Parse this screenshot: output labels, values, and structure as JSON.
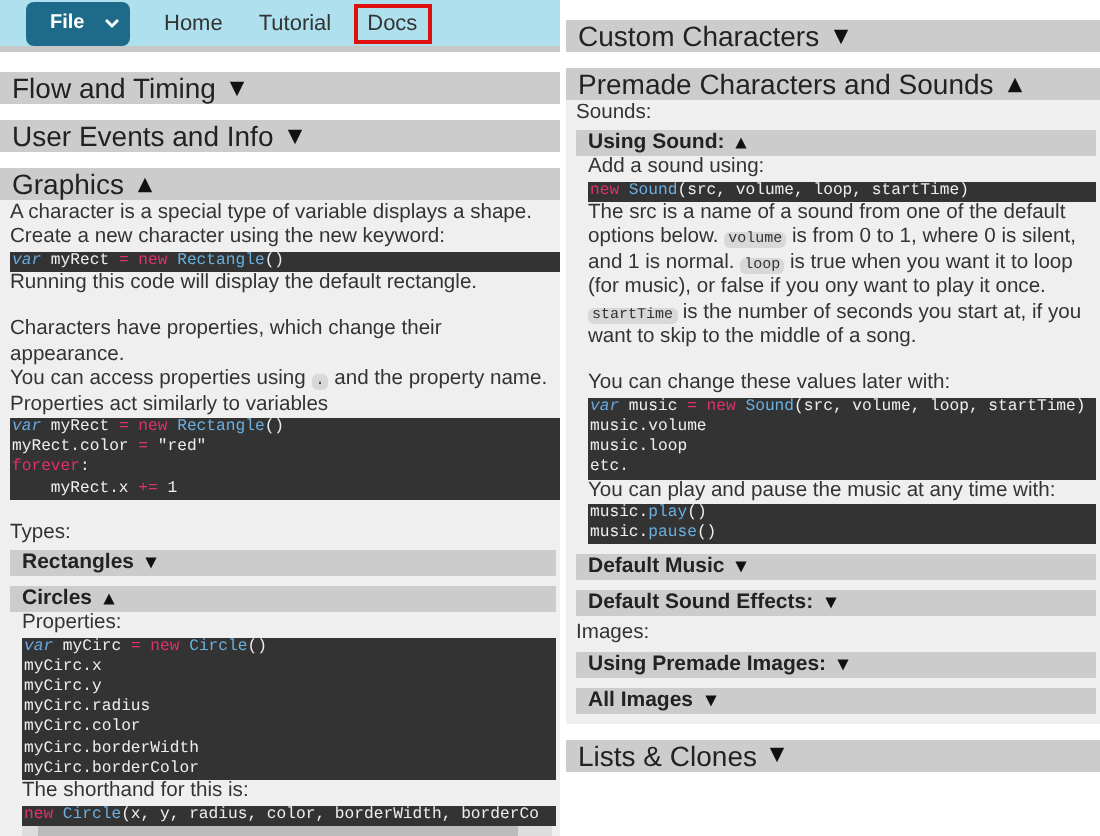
{
  "nav": {
    "file_button": "File",
    "links": [
      {
        "label": "Home",
        "selected": false
      },
      {
        "label": "Tutorial",
        "selected": false
      },
      {
        "label": "Docs",
        "selected": true
      }
    ]
  },
  "left_sections": [
    {
      "title": "Flow and Timing",
      "expanded": false
    },
    {
      "title": "User Events and Info",
      "expanded": false
    },
    {
      "title": "Graphics",
      "expanded": true,
      "blocks": [
        {
          "kind": "text",
          "parts": [
            {
              "kind": "plain",
              "text": "A character is a special type of variable displays a shape."
            }
          ]
        },
        {
          "kind": "text",
          "parts": [
            {
              "kind": "plain",
              "text": "Create a new character using the new keyword:"
            }
          ]
        },
        {
          "kind": "code",
          "lines": [
            [
              {
                "kind": "kw",
                "text": "var"
              },
              {
                "kind": "plain",
                "text": " myRect "
              },
              {
                "kind": "op",
                "text": "= new"
              },
              {
                "kind": "fn",
                "text": " Rectangle"
              },
              {
                "kind": "plain",
                "text": "()"
              }
            ]
          ]
        },
        {
          "kind": "text",
          "parts": [
            {
              "kind": "plain",
              "text": "Running this code will display the default rectangle."
            }
          ]
        },
        {
          "kind": "gap"
        },
        {
          "kind": "text",
          "parts": [
            {
              "kind": "plain",
              "text": "Characters have properties, which change their appearance."
            }
          ]
        },
        {
          "kind": "text",
          "parts": [
            {
              "kind": "plain",
              "text": "You can access properties using "
            },
            {
              "kind": "code",
              "text": "."
            },
            {
              "kind": "plain",
              "text": " and the property name."
            }
          ]
        },
        {
          "kind": "text",
          "parts": [
            {
              "kind": "plain",
              "text": "Properties act similarly to variables"
            }
          ]
        },
        {
          "kind": "code",
          "lines": [
            [
              {
                "kind": "kw",
                "text": "var"
              },
              {
                "kind": "plain",
                "text": " myRect "
              },
              {
                "kind": "op",
                "text": "= new"
              },
              {
                "kind": "fn",
                "text": " Rectangle"
              },
              {
                "kind": "plain",
                "text": "()"
              }
            ],
            [
              {
                "kind": "plain",
                "text": "myRect.color "
              },
              {
                "kind": "op",
                "text": "="
              },
              {
                "kind": "plain",
                "text": " \"red\""
              }
            ],
            [
              {
                "kind": "op",
                "text": "forever"
              },
              {
                "kind": "plain",
                "text": ":"
              }
            ],
            [
              {
                "kind": "plain",
                "text": "    myRect.x "
              },
              {
                "kind": "op",
                "text": "+="
              },
              {
                "kind": "plain",
                "text": " 1"
              }
            ]
          ]
        },
        {
          "kind": "gap"
        },
        {
          "kind": "text",
          "parts": [
            {
              "kind": "plain",
              "text": "Types:"
            }
          ]
        },
        {
          "kind": "sub",
          "title": "Rectangles",
          "expanded": false
        },
        {
          "kind": "sub",
          "title": "Circles",
          "expanded": true,
          "blocks": [
            {
              "kind": "text",
              "parts": [
                {
                  "kind": "plain",
                  "text": "Properties:"
                }
              ]
            },
            {
              "kind": "code",
              "lines": [
                [
                  {
                    "kind": "kw",
                    "text": "var"
                  },
                  {
                    "kind": "plain",
                    "text": " myCirc "
                  },
                  {
                    "kind": "op",
                    "text": "= new"
                  },
                  {
                    "kind": "fn",
                    "text": " Circle"
                  },
                  {
                    "kind": "plain",
                    "text": "()"
                  }
                ],
                [
                  {
                    "kind": "plain",
                    "text": "myCirc.x"
                  }
                ],
                [
                  {
                    "kind": "plain",
                    "text": "myCirc.y"
                  }
                ],
                [
                  {
                    "kind": "plain",
                    "text": "myCirc.radius"
                  }
                ],
                [
                  {
                    "kind": "plain",
                    "text": "myCirc.color"
                  }
                ],
                [
                  {
                    "kind": "plain",
                    "text": "myCirc.borderWidth"
                  }
                ],
                [
                  {
                    "kind": "plain",
                    "text": "myCirc.borderColor"
                  }
                ]
              ]
            },
            {
              "kind": "text",
              "parts": [
                {
                  "kind": "plain",
                  "text": "The shorthand for this is:"
                }
              ]
            },
            {
              "kind": "scrollcode",
              "lines": [
                [
                  {
                    "kind": "op",
                    "text": "new"
                  },
                  {
                    "kind": "fn",
                    "text": " Circle"
                  },
                  {
                    "kind": "plain",
                    "text": "(x, y, radius, color, borderWidth, borderCo"
                  }
                ]
              ]
            }
          ]
        }
      ]
    }
  ],
  "right_sections": [
    {
      "title": "Custom Characters",
      "expanded": false
    },
    {
      "title": "Premade Characters and Sounds",
      "expanded": true,
      "blocks": [
        {
          "kind": "text",
          "parts": [
            {
              "kind": "plain",
              "text": "Sounds:"
            }
          ]
        },
        {
          "kind": "sub",
          "title": "Using Sound:",
          "expanded": true,
          "blocks": [
            {
              "kind": "text",
              "parts": [
                {
                  "kind": "plain",
                  "text": "Add a sound using:"
                }
              ]
            },
            {
              "kind": "code",
              "lines": [
                [
                  {
                    "kind": "op",
                    "text": "new"
                  },
                  {
                    "kind": "fn",
                    "text": " Sound"
                  },
                  {
                    "kind": "plain",
                    "text": "(src, volume, loop, startTime)"
                  }
                ]
              ]
            },
            {
              "kind": "text",
              "parts": [
                {
                  "kind": "plain",
                  "text": "The src is a name of a sound from one of the default options below. "
                },
                {
                  "kind": "code",
                  "text": "volume"
                },
                {
                  "kind": "plain",
                  "text": " is from 0 to 1, where 0 is silent, and 1 is normal. "
                },
                {
                  "kind": "code",
                  "text": "loop"
                },
                {
                  "kind": "plain",
                  "text": " is true when you want it to loop (for music), or false if you ony want to play it once. "
                },
                {
                  "kind": "code",
                  "text": "startTime"
                },
                {
                  "kind": "plain",
                  "text": " is the number of seconds you start at, if you want to skip to the middle of a song."
                }
              ]
            },
            {
              "kind": "gap"
            },
            {
              "kind": "text",
              "parts": [
                {
                  "kind": "plain",
                  "text": "You can change these values later with:"
                }
              ]
            },
            {
              "kind": "code",
              "lines": [
                [
                  {
                    "kind": "kw",
                    "text": "var"
                  },
                  {
                    "kind": "plain",
                    "text": " music "
                  },
                  {
                    "kind": "op",
                    "text": "= new"
                  },
                  {
                    "kind": "fn",
                    "text": " Sound"
                  },
                  {
                    "kind": "plain",
                    "text": "(src, volume, loop, startTime)"
                  }
                ],
                [
                  {
                    "kind": "plain",
                    "text": "music.volume"
                  }
                ],
                [
                  {
                    "kind": "plain",
                    "text": "music.loop"
                  }
                ],
                [
                  {
                    "kind": "plain",
                    "text": "etc."
                  }
                ]
              ]
            },
            {
              "kind": "text",
              "parts": [
                {
                  "kind": "plain",
                  "text": "You can play and pause the music at any time with:"
                }
              ]
            },
            {
              "kind": "code",
              "lines": [
                [
                  {
                    "kind": "plain",
                    "text": "music."
                  },
                  {
                    "kind": "fn",
                    "text": "play"
                  },
                  {
                    "kind": "plain",
                    "text": "()"
                  }
                ],
                [
                  {
                    "kind": "plain",
                    "text": "music."
                  },
                  {
                    "kind": "fn",
                    "text": "pause"
                  },
                  {
                    "kind": "plain",
                    "text": "()"
                  }
                ]
              ]
            }
          ]
        },
        {
          "kind": "sub",
          "title": "Default Music",
          "expanded": false
        },
        {
          "kind": "sub",
          "title": "Default Sound Effects:",
          "expanded": false
        },
        {
          "kind": "text",
          "parts": [
            {
              "kind": "plain",
              "text": "Images:"
            }
          ]
        },
        {
          "kind": "sub",
          "title": "Using Premade Images:",
          "expanded": false
        },
        {
          "kind": "sub",
          "title": "All Images",
          "expanded": false
        }
      ]
    },
    {
      "title": "Lists & Clones",
      "expanded": false
    }
  ]
}
